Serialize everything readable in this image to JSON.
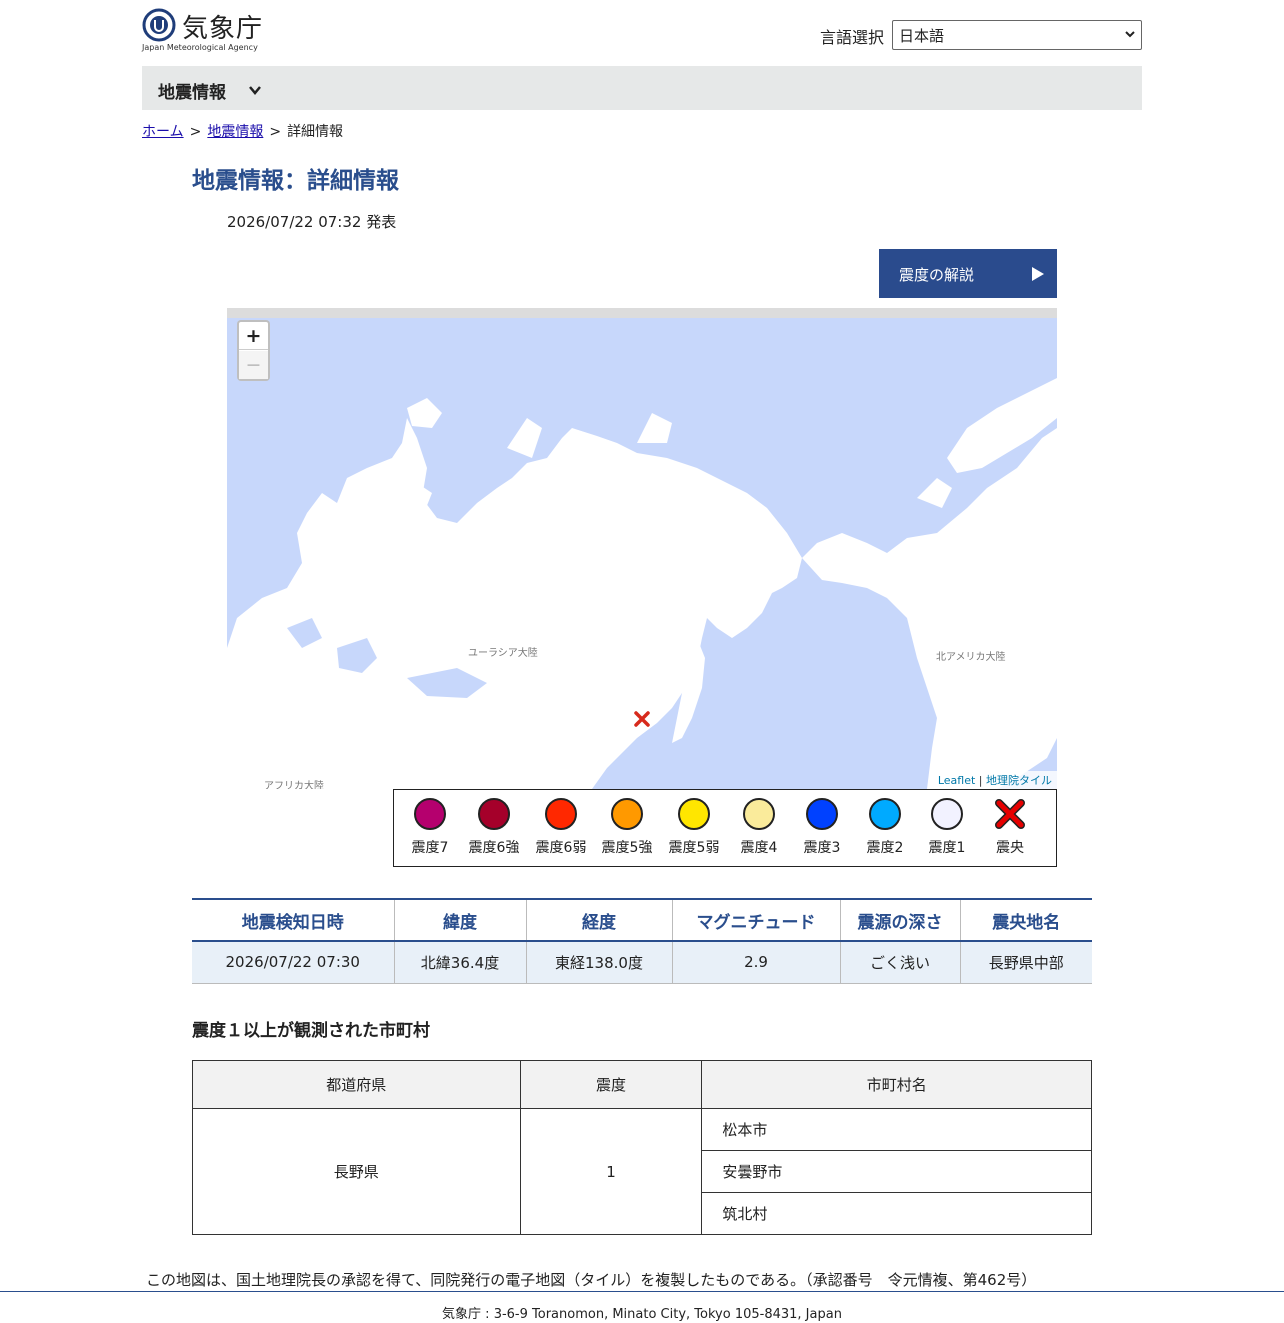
{
  "header": {
    "logo_text": "気象庁",
    "logo_sub": "Japan Meteorological Agency",
    "lang_label": "言語選択",
    "lang_value": "日本語"
  },
  "nav": {
    "title": "地震情報"
  },
  "breadcrumb": {
    "home": "ホーム",
    "section": "地震情報",
    "current": "詳細情報",
    "sep": ">"
  },
  "page": {
    "title": "地震情報：詳細情報",
    "issued": "2026/07/22 07:32 発表",
    "explain_button": "震度の解説"
  },
  "map": {
    "zoom_in": "+",
    "zoom_out": "−",
    "labels": {
      "eurasia": "ユーラシア大陸",
      "north_america": "北アメリカ大陸",
      "africa": "アフリカ大陸"
    },
    "attribution_leaflet": "Leaflet",
    "attribution_sep": "|",
    "attribution_tiles": "地理院タイル"
  },
  "legend": [
    {
      "label": "震度7",
      "color": "#b5006e"
    },
    {
      "label": "震度6強",
      "color": "#a5002a"
    },
    {
      "label": "震度6弱",
      "color": "#ff2800"
    },
    {
      "label": "震度5強",
      "color": "#ff9900"
    },
    {
      "label": "震度5弱",
      "color": "#ffe600"
    },
    {
      "label": "震度4",
      "color": "#faeb9b"
    },
    {
      "label": "震度3",
      "color": "#0041ff"
    },
    {
      "label": "震度2",
      "color": "#00aaff"
    },
    {
      "label": "震度1",
      "color": "#f2f2ff"
    },
    {
      "label": "震央",
      "color": "#e60000"
    }
  ],
  "quake_table": {
    "headers": [
      "地震検知日時",
      "緯度",
      "経度",
      "マグニチュード",
      "震源の深さ",
      "震央地名"
    ],
    "row": [
      "2026/07/22 07:30",
      "北緯36.4度",
      "東経138.0度",
      "2.9",
      "ごく浅い",
      "長野県中部"
    ]
  },
  "obs": {
    "heading": "震度１以上が観測された市町村",
    "headers": [
      "都道府県",
      "震度",
      "市町村名"
    ],
    "prefecture": "長野県",
    "intensity": "1",
    "cities": [
      "松本市",
      "安曇野市",
      "筑北村"
    ]
  },
  "notice": "この地図は、国土地理院長の承認を得て、同院発行の電子地図（タイル）を複製したものである。（承認番号　令元情複、第462号）",
  "footer": "気象庁 : 3-6-9 Toranomon, Minato City, Tokyo 105-8431, Japan"
}
